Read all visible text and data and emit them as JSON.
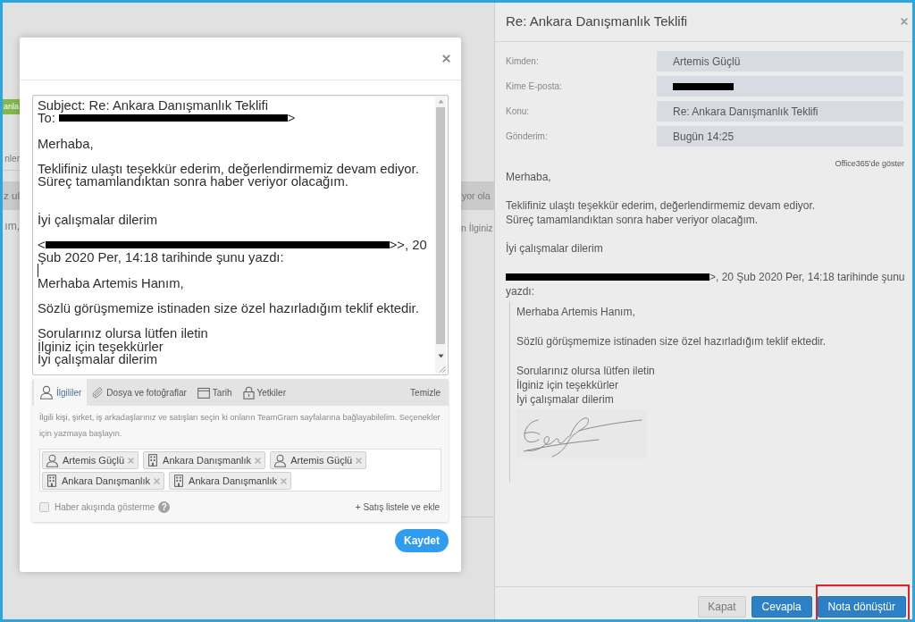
{
  "background_page": {
    "left": [
      {
        "kind": "tag",
        "text": "anla"
      },
      {
        "kind": "label",
        "text": "nler"
      },
      {
        "kind": "row",
        "text": "z ul"
      },
      {
        "kind": "text",
        "text": "ım,"
      }
    ],
    "right": [
      {
        "kind": "row",
        "text": "yor ola"
      },
      {
        "kind": "text",
        "text": "n İlginiz"
      }
    ]
  },
  "compose_modal": {
    "message": {
      "lines": [
        {
          "kind": "text",
          "text": "Subject: Re: Ankara Danışmanlık Teklifi"
        },
        {
          "kind": "mixed",
          "segments": [
            {
              "kind": "text",
              "text": "To: "
            },
            {
              "kind": "redacted"
            },
            {
              "kind": "text",
              "text": ">"
            }
          ]
        },
        {
          "kind": "blank"
        },
        {
          "kind": "text",
          "text": "Merhaba,"
        },
        {
          "kind": "blank"
        },
        {
          "kind": "text",
          "text": "Teklifiniz ulaştı teşekkür ederim, değerlendirmemiz devam ediyor."
        },
        {
          "kind": "text",
          "text": "Süreç tamamlandıktan sonra haber veriyor olacağım."
        },
        {
          "kind": "blank"
        },
        {
          "kind": "blank"
        },
        {
          "kind": "text",
          "text": "İyi çalışmalar dilerim"
        },
        {
          "kind": "blank"
        },
        {
          "kind": "mixed",
          "segments": [
            {
              "kind": "text",
              "text": "<"
            },
            {
              "kind": "redacted"
            },
            {
              "kind": "text",
              "text": ">>, 20"
            }
          ]
        },
        {
          "kind": "text",
          "text": "Şub 2020 Per, 14:18 tarihinde şunu yazdı:"
        },
        {
          "kind": "caret"
        },
        {
          "kind": "text",
          "text": "Merhaba Artemis Hanım,"
        },
        {
          "kind": "blank"
        },
        {
          "kind": "text",
          "text": "Sözlü görüşmemize istinaden size özel hazırladığım teklif ektedir."
        },
        {
          "kind": "blank"
        },
        {
          "kind": "text",
          "text": "Sorularınız olursa lütfen iletin"
        },
        {
          "kind": "text",
          "text": "İlginiz için teşekkürler"
        },
        {
          "kind": "text",
          "text": "İyi çalışmalar dilerim"
        }
      ]
    },
    "tabs": [
      {
        "label": "İlgililer",
        "selected": true
      },
      {
        "label": "Dosya ve fotoğraflar",
        "selected": false
      },
      {
        "label": "Tarih",
        "selected": false
      },
      {
        "label": "Yetkiler",
        "selected": false
      }
    ],
    "clear_link": "Temizle",
    "help_text": "İlgili kişi, şirket, iş arkadaşlarınız ve satışları seçin ki onların TeamGram sayfalarına bağlayabilelim. Seçenekler için yazmaya başlayın.",
    "tags": [
      {
        "kind": "person",
        "label": "Artemis Güçlü"
      },
      {
        "kind": "company",
        "label": "Ankara Danışmanlık"
      },
      {
        "kind": "person",
        "label": "Artemis Güçlü"
      },
      {
        "kind": "company",
        "label": "Ankara Danışmanlık"
      },
      {
        "kind": "company",
        "label": "Ankara Danışmanlık"
      }
    ],
    "hide_from_feed": {
      "label": "Haber akışında gösterme",
      "checked": false,
      "help_mark": "?"
    },
    "add_sale_link": "+ Satış listele ve ekle",
    "save_button": "Kaydet"
  },
  "email_panel": {
    "title": "Re: Ankara Danışmanlık Teklifi",
    "fields": [
      {
        "label": "Kimden:",
        "value": "Artemis Güçlü"
      },
      {
        "label": "Kime E-posta:",
        "redacted": true
      },
      {
        "label": "Konu:",
        "value": "Re: Ankara Danışmanlık Teklifi"
      },
      {
        "label": "Gönderim:",
        "value": "Bugün 14:25"
      }
    ],
    "office_link": "Office365'de göster",
    "body": [
      [
        "Merhaba,"
      ],
      [
        "Teklifiniz ulaştı teşekkür ederim, değerlendirmemiz devam ediyor.",
        "Süreç tamamlandıktan sonra haber veriyor olacağım."
      ],
      [
        "İyi çalışmalar dilerim"
      ]
    ],
    "attribution": [
      [
        {
          "kind": "redacted"
        },
        {
          "kind": "text",
          "text": ">, 20 Şub 2020 Per, 14:18 tarihinde şunu"
        }
      ],
      [
        {
          "kind": "text",
          "text": "yazdı:"
        }
      ]
    ],
    "quote": [
      [
        "Merhaba Artemis Hanım,"
      ],
      [
        "Sözlü görüşmemize istinaden size özel hazırladığım teklif ektedir."
      ],
      [
        "Sorularınız olursa lütfen iletin",
        "İlginiz için teşekkürler",
        "İyi çalışmalar dilerim"
      ]
    ],
    "buttons": [
      {
        "kind": "secondary",
        "label": "Kapat",
        "highlighted": false
      },
      {
        "kind": "primary",
        "label": "Cevapla",
        "highlighted": false
      },
      {
        "kind": "primary",
        "label": "Nota dönüştür",
        "highlighted": true
      }
    ]
  }
}
